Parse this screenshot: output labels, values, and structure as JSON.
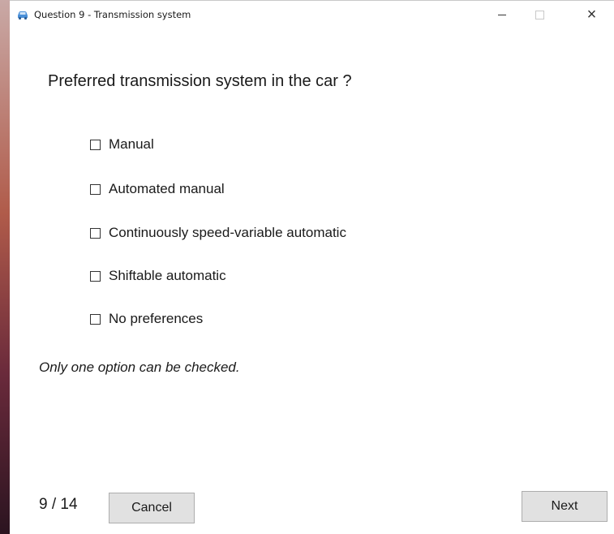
{
  "window": {
    "title": "Question 9 - Transmission system",
    "icon": "car-icon",
    "controls": {
      "minimize": "minimize-icon",
      "maximize": "maximize-icon",
      "close": "×"
    }
  },
  "question": {
    "text": "Preferred transmission system in the car ?"
  },
  "options": [
    {
      "label": "Manual",
      "checked": false
    },
    {
      "label": "Automated manual",
      "checked": false
    },
    {
      "label": "Continuously speed-variable automatic",
      "checked": false
    },
    {
      "label": "Shiftable automatic",
      "checked": false
    },
    {
      "label": "No preferences",
      "checked": false
    }
  ],
  "hint": "Only one option can be checked.",
  "footer": {
    "progress": "9 / 14",
    "cancel_label": "Cancel",
    "next_label": "Next"
  },
  "colors": {
    "icon_accent": "#4a90d9",
    "button_bg": "#e1e1e1",
    "button_border": "#adadad"
  }
}
